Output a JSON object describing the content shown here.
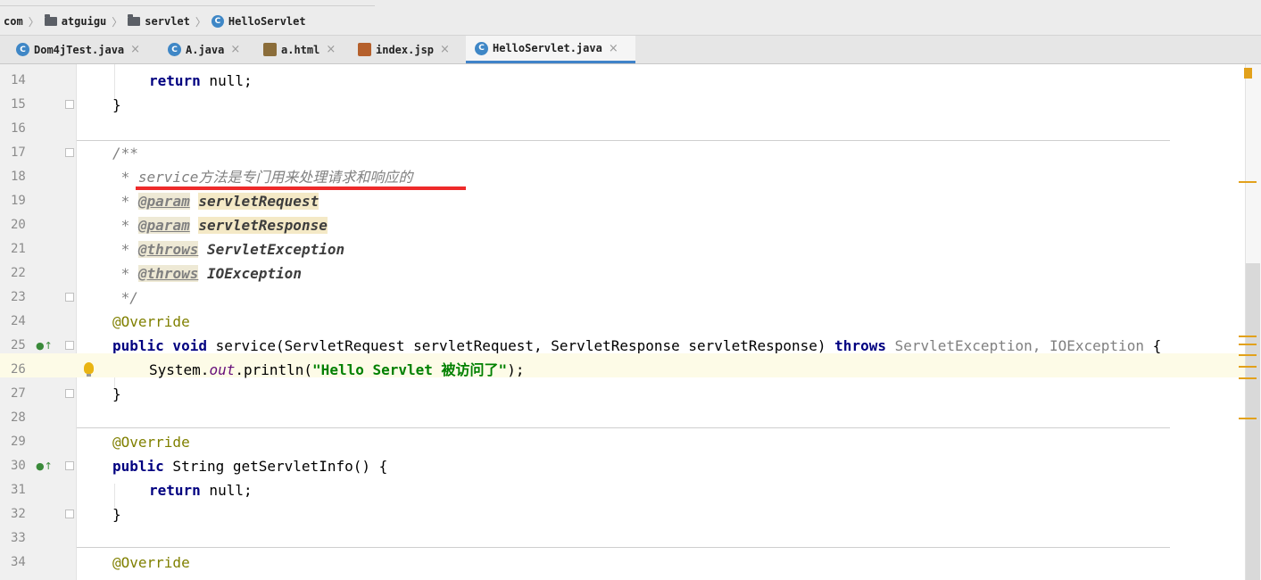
{
  "breadcrumb": {
    "items": [
      {
        "label": "com",
        "icon": "none"
      },
      {
        "label": "atguigu",
        "icon": "folder-icon"
      },
      {
        "label": "servlet",
        "icon": "folder-icon"
      },
      {
        "label": "HelloServlet",
        "icon": "class-icon"
      }
    ],
    "separator": "〉"
  },
  "tabs": [
    {
      "label": "Dom4jTest.java",
      "icon": "java-class-icon",
      "close": "×",
      "active": false
    },
    {
      "label": "A.java",
      "icon": "java-class-icon",
      "close": "×",
      "active": false
    },
    {
      "label": "a.html",
      "icon": "html-file-icon",
      "close": "×",
      "active": false
    },
    {
      "label": "index.jsp",
      "icon": "jsp-file-icon",
      "close": "×",
      "active": false
    },
    {
      "label": "HelloServlet.java",
      "icon": "java-class-icon",
      "close": "×",
      "active": true
    }
  ],
  "editor": {
    "line_numbers": [
      "14",
      "15",
      "16",
      "17",
      "18",
      "19",
      "20",
      "21",
      "22",
      "23",
      "24",
      "25",
      "26",
      "27",
      "28",
      "29",
      "30",
      "31",
      "32",
      "33",
      "34"
    ],
    "current_line": "26",
    "code": {
      "l14_kw": "return",
      "l14_rest": " null;",
      "l15": "}",
      "l17": "/**",
      "l18_star": " * ",
      "l18_text": "service方法是专门用来处理请求和响应的",
      "l19_star": " * ",
      "l19_tag": "@param",
      "l19_name": "servletRequest",
      "l20_star": " * ",
      "l20_tag": "@param",
      "l20_name": "servletResponse",
      "l21_star": " * ",
      "l21_tag": "@throws",
      "l21_name": "ServletException",
      "l22_star": " * ",
      "l22_tag": "@throws",
      "l22_name": "IOException",
      "l23": " */",
      "l24": "@Override",
      "l25_kw": "public void",
      "l25_mid": " service(ServletRequest servletRequest, ServletResponse servletResponse) ",
      "l25_throws": "throws",
      "l25_exc": " ServletException, IOException",
      "l25_end": " {",
      "l26_pre": "System.",
      "l26_field": "out",
      "l26_mid": ".println(",
      "l26_str": "\"Hello Servlet 被访问了\"",
      "l26_end": ");",
      "l27": "}",
      "l29": "@Override",
      "l30_kw": "public",
      "l30_rest": " String getServletInfo() {",
      "l31_kw": "return",
      "l31_rest": " null;",
      "l32": "}",
      "l34": "@Override"
    }
  },
  "colors": {
    "keyword": "#000080",
    "annotation": "#808000",
    "string": "#008000",
    "comment": "#808080",
    "highlight_underline": "#ee2a2a",
    "active_tab_indicator": "#4083c9",
    "marker": "#e2a11b"
  }
}
